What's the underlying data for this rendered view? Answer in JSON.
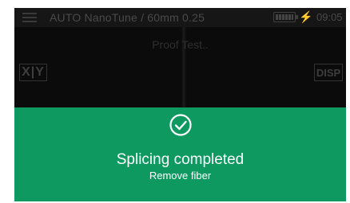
{
  "status_bar": {
    "title": "AUTO NanoTune / 60mm 0.25",
    "clock": "09:05",
    "icons": [
      "menu-icon",
      "battery-icon",
      "lightning-icon"
    ]
  },
  "view": {
    "overlay_text": "Proof Test..",
    "xy_label": "X|Y",
    "disp_label": "DISP"
  },
  "banner": {
    "icon": "check-circle-icon",
    "message": "Splicing completed",
    "sub_message": "Remove fiber",
    "color": "#0d9960"
  }
}
